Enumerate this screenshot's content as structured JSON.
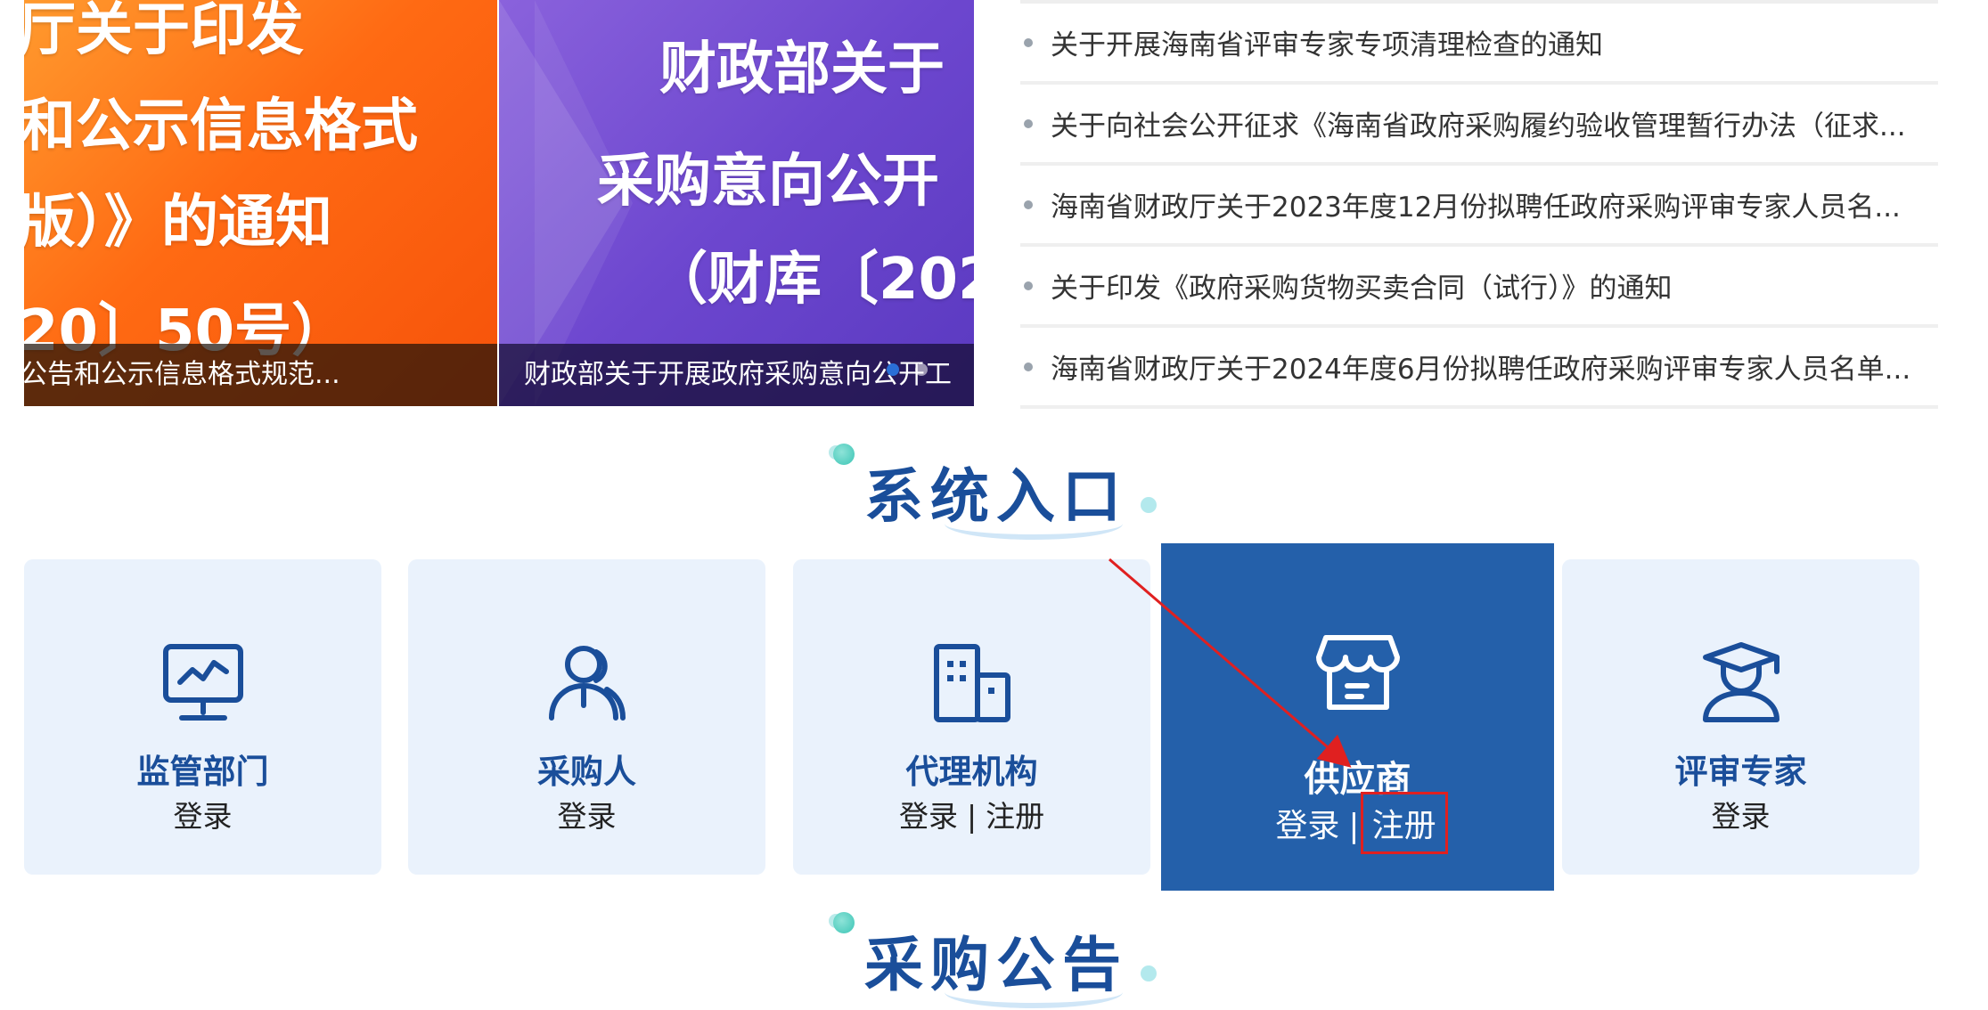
{
  "banner": {
    "slide1": {
      "lines": [
        "厅关于印发",
        "和公示信息格式",
        "版）》的通知",
        "20〕50号）"
      ],
      "caption": "公告和公示信息格式规范..."
    },
    "slide2": {
      "lines": [
        "财政部关于",
        "采购意向公开",
        "（财库〔202"
      ],
      "caption": "财政部关于开展政府采购意向公开工"
    }
  },
  "news": [
    "关于开展海南省评审专家专项清理检查的通知",
    "关于向社会公开征求《海南省政府采购履约验收管理暂行办法（征求...",
    "海南省财政厅关于2023年度12月份拟聘任政府采购评审专家人员名...",
    "关于印发《政府采购货物买卖合同（试行）》的通知",
    "海南省财政厅关于2024年度6月份拟聘任政府采购评审专家人员名单..."
  ],
  "sections": {
    "system_entry": "系统入口",
    "procurement_notice": "采购公告"
  },
  "entries": [
    {
      "title": "监管部门",
      "login": "登录",
      "icon": "monitor-chart-icon"
    },
    {
      "title": "采购人",
      "login": "登录",
      "icon": "users-icon"
    },
    {
      "title": "代理机构",
      "login": "登录",
      "separator": "|",
      "register": "注册",
      "icon": "building-icon"
    },
    {
      "title": "供应商",
      "login": "登录",
      "separator": "|",
      "register": "注册",
      "icon": "storefront-icon"
    },
    {
      "title": "评审专家",
      "login": "登录",
      "icon": "graduate-icon"
    }
  ],
  "colors": {
    "brand_blue": "#1a4e9a",
    "active_card": "#2460aa",
    "card_bg": "#eaf2fc",
    "highlight_red": "#e02020"
  }
}
